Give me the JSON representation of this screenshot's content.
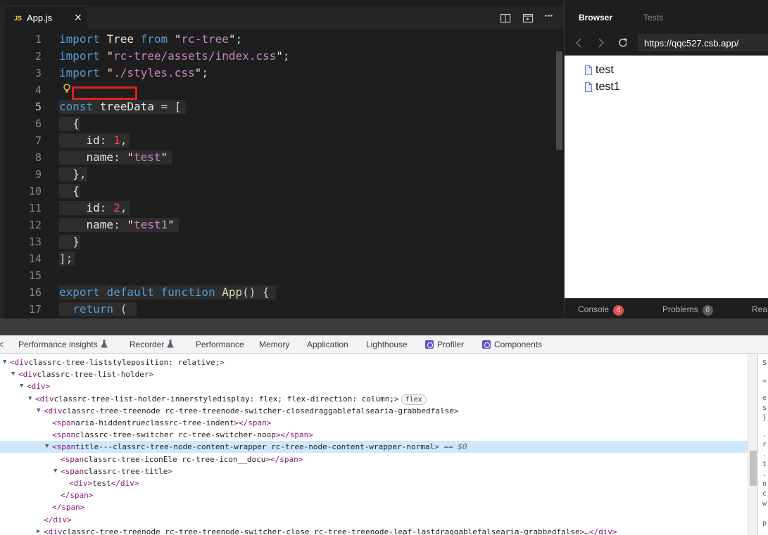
{
  "editor": {
    "tab": {
      "icon": "JS",
      "label": "App.js",
      "close": "×"
    },
    "actions": [
      "split-editor-icon",
      "preview-icon",
      "more-icon"
    ],
    "more_label": "···",
    "lines": [
      {
        "n": "1",
        "text": "import Tree from \"rc-tree\";"
      },
      {
        "n": "2",
        "text": "import \"rc-tree/assets/index.css\";"
      },
      {
        "n": "3",
        "text": "import \"./styles.css\";"
      },
      {
        "n": "4",
        "text": ""
      },
      {
        "n": "5",
        "text": "const treeData = ["
      },
      {
        "n": "6",
        "text": "  {"
      },
      {
        "n": "7",
        "text": "    id: 1,"
      },
      {
        "n": "8",
        "text": "    name: \"test\""
      },
      {
        "n": "9",
        "text": "  },"
      },
      {
        "n": "10",
        "text": "  {"
      },
      {
        "n": "11",
        "text": "    id: 2,"
      },
      {
        "n": "12",
        "text": "    name: \"test1\""
      },
      {
        "n": "13",
        "text": "  }"
      },
      {
        "n": "14",
        "text": "];"
      },
      {
        "n": "15",
        "text": ""
      },
      {
        "n": "16",
        "text": "export default function App() {"
      },
      {
        "n": "17",
        "text": "  return ("
      }
    ]
  },
  "browser": {
    "tabs": [
      {
        "label": "Browser",
        "active": true
      },
      {
        "label": "Tests",
        "active": false
      }
    ],
    "url": "https://qqc527.csb.app/",
    "tree_items": [
      "test",
      "test1"
    ],
    "bottom_bar": {
      "console_label": "Console",
      "console_count": "4",
      "problems_label": "Problems",
      "problems_count": "0",
      "third_label": "Rea"
    }
  },
  "devtools": {
    "tabs": [
      {
        "label": "<",
        "icon": null
      },
      {
        "label": "Performance insights",
        "icon": "flask-icon"
      },
      {
        "label": "Recorder",
        "icon": "flask-icon"
      },
      {
        "label": "Performance",
        "icon": null
      },
      {
        "label": "Memory",
        "icon": null
      },
      {
        "label": "Application",
        "icon": null
      },
      {
        "label": "Lighthouse",
        "icon": null
      },
      {
        "label": "Profiler",
        "icon": "react-icon"
      },
      {
        "label": "Components",
        "icon": "react-icon"
      }
    ],
    "dom_lines": [
      "<div class=\"rc-tree-list\" style=\"position: relative;\">",
      "<div class=\"rc-tree-list-holder\">",
      "<div>",
      "<div class=\"rc-tree-list-holder-inner\" style=\"display: flex; flex-direction: column;\">",
      "<div class=\"rc-tree-treenode rc-tree-treenode-switcher-close\" draggable=\"false\" aria-grabbed=\"false\">",
      "<span aria-hidden=\"true\" class=\"rc-tree-indent\"></span>",
      "<span class=\"rc-tree-switcher rc-tree-switcher-noop\"></span>",
      "<span title=\"---\" class=\"rc-tree-node-content-wrapper rc-tree-node-content-wrapper-normal\">",
      "<span class=\"rc-tree-iconEle rc-tree-icon__docu\"></span>",
      "<span class=\"rc-tree-title\">",
      "<div>test</div>",
      "</span>",
      "</span>",
      "</div>",
      "<div class=\"rc-tree-treenode rc-tree-treenode-switcher-close rc-tree-treenode-leaf-last\" draggable=\"false\" aria-grabbed=\"false\">…</div>"
    ],
    "flex_badge": "flex",
    "selected_suffix": "== $0",
    "styles_panel_chars": [
      "S",
      "=",
      "e",
      "s",
      "}",
      ".",
      "r",
      ".",
      "t",
      ".",
      "n",
      "c",
      "w",
      "p"
    ]
  },
  "colors": {
    "editor_bg": "#1e1e1e",
    "keyword": "#569cd6",
    "string": "#c586c0",
    "number": "#f44747",
    "function": "#dcdcaa",
    "console_badge": "#e05252",
    "selection_highlight": "#cfe8fc",
    "annotation_box": "#e02020"
  }
}
